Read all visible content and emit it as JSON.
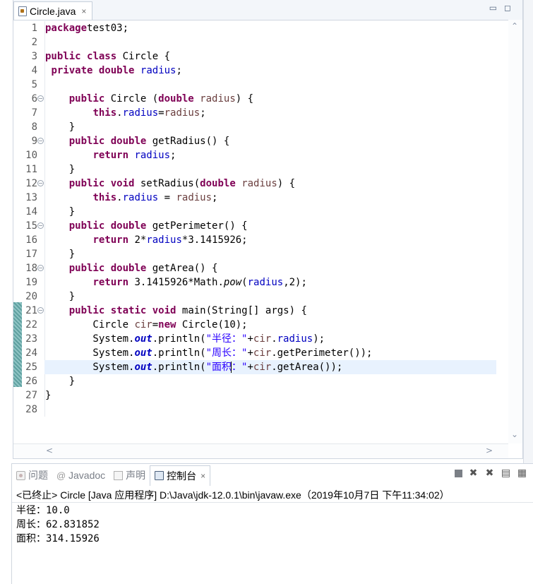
{
  "editor": {
    "tab_title": "Circle.java",
    "tab_close": "×",
    "win_minimize": "▭",
    "win_maximize": "◻",
    "scroll_up": "⌃",
    "scroll_down": "⌄",
    "scroll_left": "<",
    "scroll_right": ">",
    "line_numbers": [
      "1",
      "2",
      "3",
      "4",
      "5",
      "6",
      "7",
      "8",
      "9",
      "10",
      "11",
      "12",
      "13",
      "14",
      "15",
      "16",
      "17",
      "18",
      "19",
      "20",
      "21",
      "22",
      "23",
      "24",
      "25",
      "26",
      "27",
      "28"
    ],
    "fold_lines": [
      6,
      9,
      12,
      15,
      18,
      21
    ],
    "current_line": 25,
    "code": [
      [
        [
          "kw",
          "package"
        ],
        [
          "",
          "test03;"
        ]
      ],
      [],
      [
        [
          "kw",
          "public"
        ],
        [
          "",
          " "
        ],
        [
          "kw",
          "class"
        ],
        [
          "",
          " Circle {"
        ]
      ],
      [
        [
          "",
          " "
        ],
        [
          "kw",
          "private"
        ],
        [
          "",
          " "
        ],
        [
          "kw",
          "double"
        ],
        [
          "",
          " "
        ],
        [
          "fd",
          "radius"
        ],
        [
          "",
          ";"
        ]
      ],
      [],
      [
        [
          "",
          "    "
        ],
        [
          "kw",
          "public"
        ],
        [
          "",
          " Circle ("
        ],
        [
          "kw",
          "double"
        ],
        [
          "",
          " "
        ],
        [
          "pm",
          "radius"
        ],
        [
          "",
          ") {"
        ]
      ],
      [
        [
          "",
          "        "
        ],
        [
          "kw",
          "this"
        ],
        [
          "",
          "."
        ],
        [
          "fd",
          "radius"
        ],
        [
          "",
          "="
        ],
        [
          "pm",
          "radius"
        ],
        [
          "",
          ";"
        ]
      ],
      [
        [
          "",
          "    }"
        ]
      ],
      [
        [
          "",
          "    "
        ],
        [
          "kw",
          "public"
        ],
        [
          "",
          " "
        ],
        [
          "kw",
          "double"
        ],
        [
          "",
          " getRadius() {"
        ]
      ],
      [
        [
          "",
          "        "
        ],
        [
          "kw",
          "return"
        ],
        [
          "",
          " "
        ],
        [
          "fd",
          "radius"
        ],
        [
          "",
          ";"
        ]
      ],
      [
        [
          "",
          "    }"
        ]
      ],
      [
        [
          "",
          "    "
        ],
        [
          "kw",
          "public"
        ],
        [
          "",
          " "
        ],
        [
          "kw",
          "void"
        ],
        [
          "",
          " setRadius("
        ],
        [
          "kw",
          "double"
        ],
        [
          "",
          " "
        ],
        [
          "pm",
          "radius"
        ],
        [
          "",
          ") {"
        ]
      ],
      [
        [
          "",
          "        "
        ],
        [
          "kw",
          "this"
        ],
        [
          "",
          "."
        ],
        [
          "fd",
          "radius"
        ],
        [
          "",
          " = "
        ],
        [
          "pm",
          "radius"
        ],
        [
          "",
          ";"
        ]
      ],
      [
        [
          "",
          "    }"
        ]
      ],
      [
        [
          "",
          "    "
        ],
        [
          "kw",
          "public"
        ],
        [
          "",
          " "
        ],
        [
          "kw",
          "double"
        ],
        [
          "",
          " getPerimeter() {"
        ]
      ],
      [
        [
          "",
          "        "
        ],
        [
          "kw",
          "return"
        ],
        [
          "",
          " 2*"
        ],
        [
          "fd",
          "radius"
        ],
        [
          "",
          "*3.1415926;"
        ]
      ],
      [
        [
          "",
          "    }"
        ]
      ],
      [
        [
          "",
          "    "
        ],
        [
          "kw",
          "public"
        ],
        [
          "",
          " "
        ],
        [
          "kw",
          "double"
        ],
        [
          "",
          " getArea() {"
        ]
      ],
      [
        [
          "",
          "        "
        ],
        [
          "kw",
          "return"
        ],
        [
          "",
          " 3.1415926*Math."
        ],
        [
          "mt",
          "pow"
        ],
        [
          "",
          "("
        ],
        [
          "fd",
          "radius"
        ],
        [
          "",
          ",2);"
        ]
      ],
      [
        [
          "",
          "    }"
        ]
      ],
      [
        [
          "",
          "    "
        ],
        [
          "kw",
          "public"
        ],
        [
          "",
          " "
        ],
        [
          "kw",
          "static"
        ],
        [
          "",
          " "
        ],
        [
          "kw",
          "void"
        ],
        [
          "",
          " main(String[] args) {"
        ]
      ],
      [
        [
          "",
          "        Circle "
        ],
        [
          "pm",
          "cir"
        ],
        [
          "",
          "="
        ],
        [
          "kw",
          "new"
        ],
        [
          "",
          " Circle(10);"
        ]
      ],
      [
        [
          "",
          "        System."
        ],
        [
          "st",
          "out"
        ],
        [
          "",
          ".println("
        ],
        [
          "str",
          "\"半径：\""
        ],
        [
          "",
          "+"
        ],
        [
          "pm",
          "cir"
        ],
        [
          "",
          "."
        ],
        [
          "fd",
          "radius"
        ],
        [
          "",
          ");"
        ]
      ],
      [
        [
          "",
          "        System."
        ],
        [
          "st",
          "out"
        ],
        [
          "",
          ".println("
        ],
        [
          "str",
          "\"周长：\""
        ],
        [
          "",
          "+"
        ],
        [
          "pm",
          "cir"
        ],
        [
          "",
          ".getPerimeter());"
        ]
      ],
      [
        [
          "",
          "        System."
        ],
        [
          "st",
          "out"
        ],
        [
          "",
          ".println("
        ],
        [
          "str",
          "\"面积"
        ],
        [
          "caret",
          ""
        ],
        [
          "str",
          "：\""
        ],
        [
          "",
          "+"
        ],
        [
          "pm",
          "cir"
        ],
        [
          "",
          ".getArea());"
        ]
      ],
      [
        [
          "",
          "    }"
        ]
      ],
      [
        [
          "",
          "}"
        ]
      ],
      []
    ]
  },
  "console": {
    "tabs": [
      {
        "label": "问题",
        "icon": "problems-icon",
        "active": false
      },
      {
        "label": "Javadoc",
        "icon": "at-icon",
        "active": false
      },
      {
        "label": "声明",
        "icon": "declaration-icon",
        "active": false
      },
      {
        "label": "控制台",
        "icon": "console-icon",
        "active": true
      }
    ],
    "tab_close": "×",
    "header": "<已终止> Circle [Java 应用程序] D:\\Java\\jdk-12.0.1\\bin\\javaw.exe（2019年10月7日 下午11:34:02）",
    "output": [
      "半径：10.0",
      "周长：62.831852",
      "面积：314.15926"
    ],
    "toolbar": {
      "remove_launch": "✖",
      "remove_all": "✖",
      "scroll_lock": "▤",
      "pin": "▦"
    }
  }
}
